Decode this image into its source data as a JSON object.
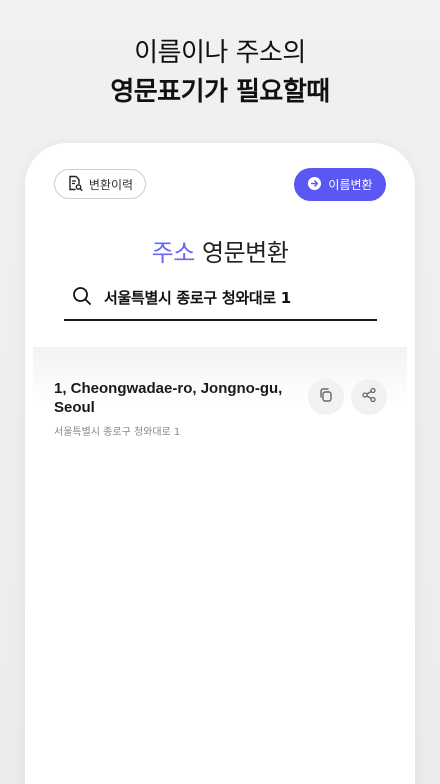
{
  "hero": {
    "line1": "이름이나 주소의",
    "line2": "영문표기가 필요할때"
  },
  "toolbar": {
    "history_label": "변환이력",
    "convert_label": "이름변환"
  },
  "section": {
    "title_accent": "주소",
    "title_rest": "영문변환"
  },
  "search": {
    "query": "서울특별시 종로구 청와대로 1"
  },
  "results": [
    {
      "english": "1, Cheongwadae-ro, Jongno-gu, Seoul",
      "korean": "서울특별시 종로구 청와대로 1"
    }
  ],
  "colors": {
    "accent": "#5b57f2",
    "accent_text": "#6a66f2"
  },
  "icons": {
    "history": "document-search-icon",
    "convert": "arrow-right-circle-icon",
    "search": "search-icon",
    "copy": "copy-icon",
    "share": "share-icon"
  }
}
